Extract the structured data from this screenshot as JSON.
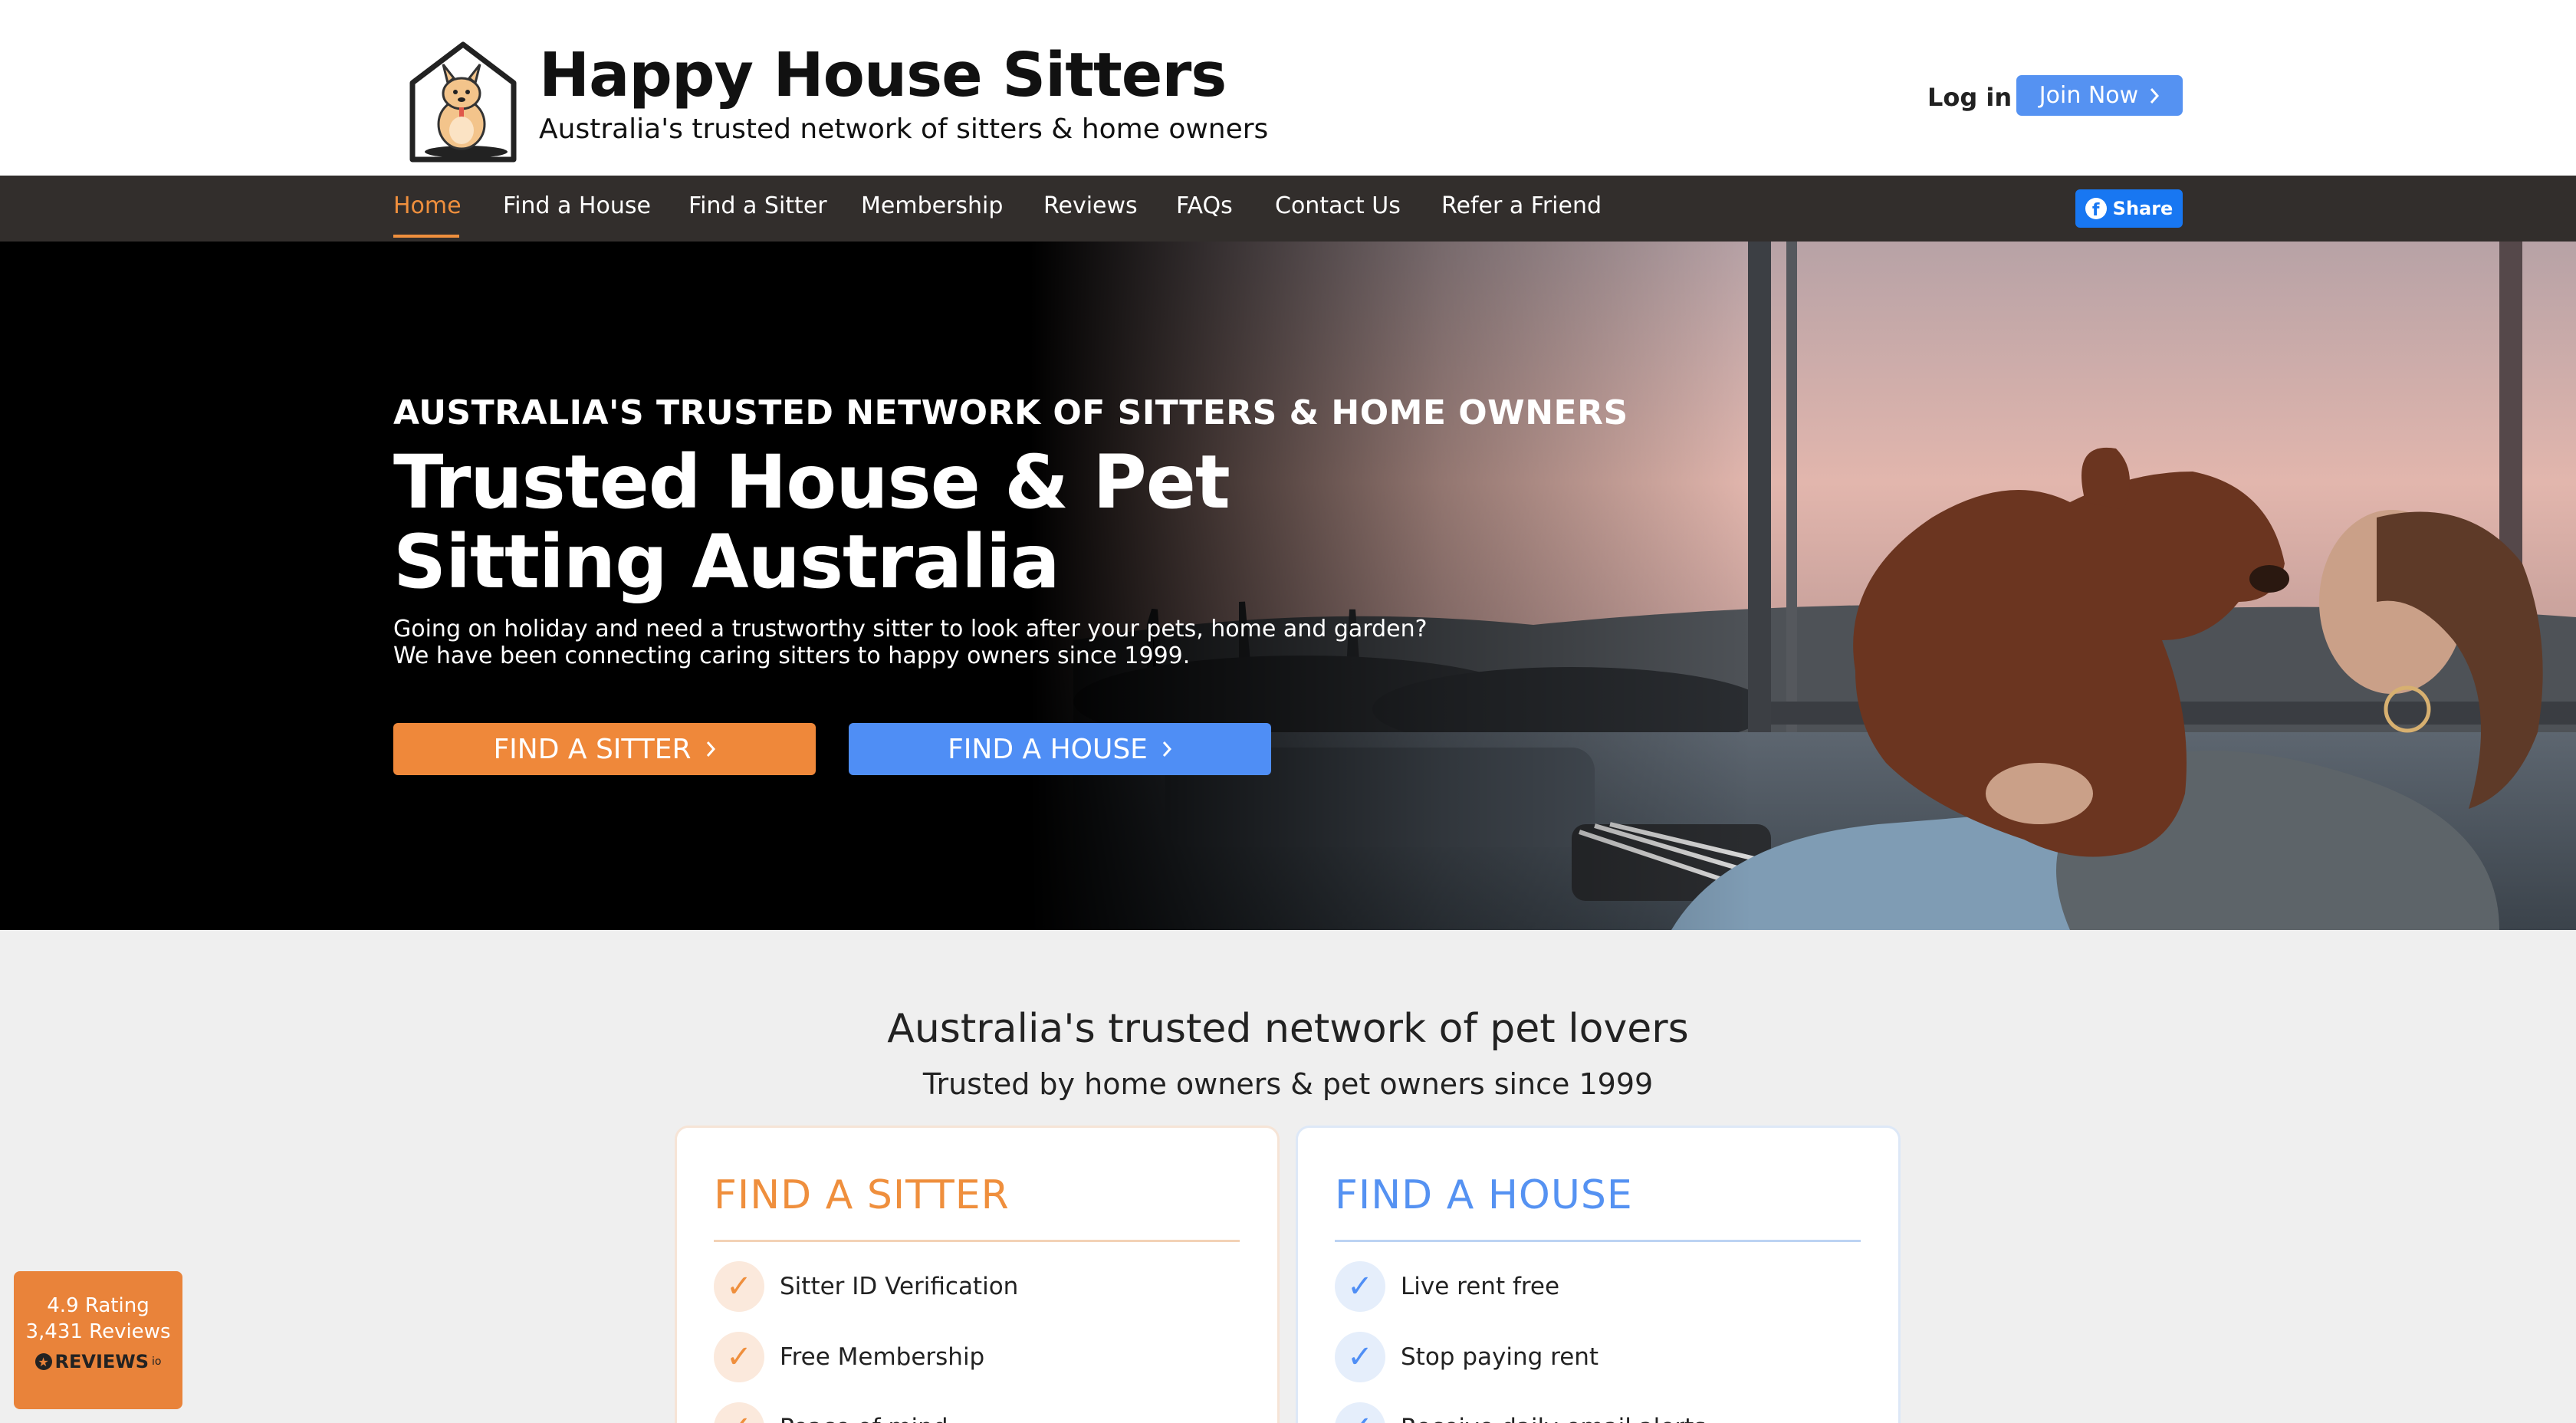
{
  "header": {
    "brand_name": "Happy House Sitters",
    "tagline": "Australia's trusted network of sitters & home owners",
    "login_label": "Log in",
    "join_label": "Join Now",
    "logo_icon": "house-with-kangaroo-logo"
  },
  "nav": {
    "items": [
      {
        "label": "Home",
        "active": true
      },
      {
        "label": "Find a House"
      },
      {
        "label": "Find a Sitter"
      },
      {
        "label": "Membership"
      },
      {
        "label": "Reviews"
      },
      {
        "label": "FAQs"
      },
      {
        "label": "Contact Us"
      },
      {
        "label": "Refer a Friend"
      }
    ],
    "share_label": "Share",
    "share_icon": "facebook-icon"
  },
  "hero": {
    "eyebrow": "AUSTRALIA'S TRUSTED NETWORK OF SITTERS & HOME OWNERS",
    "title": "Trusted House & Pet Sitting Australia",
    "description": "Going on holiday and need a trustworthy sitter to look after your pets, home and garden? We have been connecting caring sitters to happy owners since 1999.",
    "btn_sitter": "FIND A SITTER",
    "btn_house": "FIND A HOUSE",
    "image_subject": "woman-lifting-curly-dog-photo"
  },
  "section": {
    "title": "Australia's trusted network of pet lovers",
    "subtitle": "Trusted by home owners & pet owners since 1999"
  },
  "cards": {
    "sitter": {
      "title": "FIND A SITTER",
      "items": [
        "Sitter ID Verification",
        "Free Membership",
        "Peace of mind"
      ]
    },
    "house": {
      "title": "FIND A HOUSE",
      "items": [
        "Live rent free",
        "Stop paying rent",
        "Receive daily email alerts"
      ]
    }
  },
  "reviews_badge": {
    "rating": "4.9 Rating",
    "count": "3,431 Reviews",
    "brand": "REVIEWS",
    "brand_suffix": "io"
  },
  "colors": {
    "orange": "#ef8f3d",
    "blue": "#5592f2",
    "nav_bg": "#322e2c",
    "facebook": "#1877f2"
  }
}
